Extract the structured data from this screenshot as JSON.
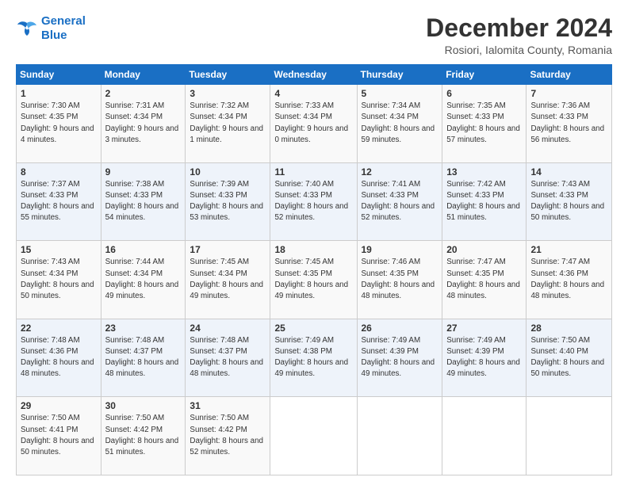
{
  "logo": {
    "line1": "General",
    "line2": "Blue"
  },
  "title": "December 2024",
  "subtitle": "Rosiori, Ialomita County, Romania",
  "weekdays": [
    "Sunday",
    "Monday",
    "Tuesday",
    "Wednesday",
    "Thursday",
    "Friday",
    "Saturday"
  ],
  "weeks": [
    [
      {
        "day": "1",
        "sunrise": "7:30 AM",
        "sunset": "4:35 PM",
        "daylight": "9 hours and 4 minutes."
      },
      {
        "day": "2",
        "sunrise": "7:31 AM",
        "sunset": "4:34 PM",
        "daylight": "9 hours and 3 minutes."
      },
      {
        "day": "3",
        "sunrise": "7:32 AM",
        "sunset": "4:34 PM",
        "daylight": "9 hours and 1 minute."
      },
      {
        "day": "4",
        "sunrise": "7:33 AM",
        "sunset": "4:34 PM",
        "daylight": "9 hours and 0 minutes."
      },
      {
        "day": "5",
        "sunrise": "7:34 AM",
        "sunset": "4:34 PM",
        "daylight": "8 hours and 59 minutes."
      },
      {
        "day": "6",
        "sunrise": "7:35 AM",
        "sunset": "4:33 PM",
        "daylight": "8 hours and 57 minutes."
      },
      {
        "day": "7",
        "sunrise": "7:36 AM",
        "sunset": "4:33 PM",
        "daylight": "8 hours and 56 minutes."
      }
    ],
    [
      {
        "day": "8",
        "sunrise": "7:37 AM",
        "sunset": "4:33 PM",
        "daylight": "8 hours and 55 minutes."
      },
      {
        "day": "9",
        "sunrise": "7:38 AM",
        "sunset": "4:33 PM",
        "daylight": "8 hours and 54 minutes."
      },
      {
        "day": "10",
        "sunrise": "7:39 AM",
        "sunset": "4:33 PM",
        "daylight": "8 hours and 53 minutes."
      },
      {
        "day": "11",
        "sunrise": "7:40 AM",
        "sunset": "4:33 PM",
        "daylight": "8 hours and 52 minutes."
      },
      {
        "day": "12",
        "sunrise": "7:41 AM",
        "sunset": "4:33 PM",
        "daylight": "8 hours and 52 minutes."
      },
      {
        "day": "13",
        "sunrise": "7:42 AM",
        "sunset": "4:33 PM",
        "daylight": "8 hours and 51 minutes."
      },
      {
        "day": "14",
        "sunrise": "7:43 AM",
        "sunset": "4:33 PM",
        "daylight": "8 hours and 50 minutes."
      }
    ],
    [
      {
        "day": "15",
        "sunrise": "7:43 AM",
        "sunset": "4:34 PM",
        "daylight": "8 hours and 50 minutes."
      },
      {
        "day": "16",
        "sunrise": "7:44 AM",
        "sunset": "4:34 PM",
        "daylight": "8 hours and 49 minutes."
      },
      {
        "day": "17",
        "sunrise": "7:45 AM",
        "sunset": "4:34 PM",
        "daylight": "8 hours and 49 minutes."
      },
      {
        "day": "18",
        "sunrise": "7:45 AM",
        "sunset": "4:35 PM",
        "daylight": "8 hours and 49 minutes."
      },
      {
        "day": "19",
        "sunrise": "7:46 AM",
        "sunset": "4:35 PM",
        "daylight": "8 hours and 48 minutes."
      },
      {
        "day": "20",
        "sunrise": "7:47 AM",
        "sunset": "4:35 PM",
        "daylight": "8 hours and 48 minutes."
      },
      {
        "day": "21",
        "sunrise": "7:47 AM",
        "sunset": "4:36 PM",
        "daylight": "8 hours and 48 minutes."
      }
    ],
    [
      {
        "day": "22",
        "sunrise": "7:48 AM",
        "sunset": "4:36 PM",
        "daylight": "8 hours and 48 minutes."
      },
      {
        "day": "23",
        "sunrise": "7:48 AM",
        "sunset": "4:37 PM",
        "daylight": "8 hours and 48 minutes."
      },
      {
        "day": "24",
        "sunrise": "7:48 AM",
        "sunset": "4:37 PM",
        "daylight": "8 hours and 48 minutes."
      },
      {
        "day": "25",
        "sunrise": "7:49 AM",
        "sunset": "4:38 PM",
        "daylight": "8 hours and 49 minutes."
      },
      {
        "day": "26",
        "sunrise": "7:49 AM",
        "sunset": "4:39 PM",
        "daylight": "8 hours and 49 minutes."
      },
      {
        "day": "27",
        "sunrise": "7:49 AM",
        "sunset": "4:39 PM",
        "daylight": "8 hours and 49 minutes."
      },
      {
        "day": "28",
        "sunrise": "7:50 AM",
        "sunset": "4:40 PM",
        "daylight": "8 hours and 50 minutes."
      }
    ],
    [
      {
        "day": "29",
        "sunrise": "7:50 AM",
        "sunset": "4:41 PM",
        "daylight": "8 hours and 50 minutes."
      },
      {
        "day": "30",
        "sunrise": "7:50 AM",
        "sunset": "4:42 PM",
        "daylight": "8 hours and 51 minutes."
      },
      {
        "day": "31",
        "sunrise": "7:50 AM",
        "sunset": "4:42 PM",
        "daylight": "8 hours and 52 minutes."
      },
      null,
      null,
      null,
      null
    ]
  ]
}
